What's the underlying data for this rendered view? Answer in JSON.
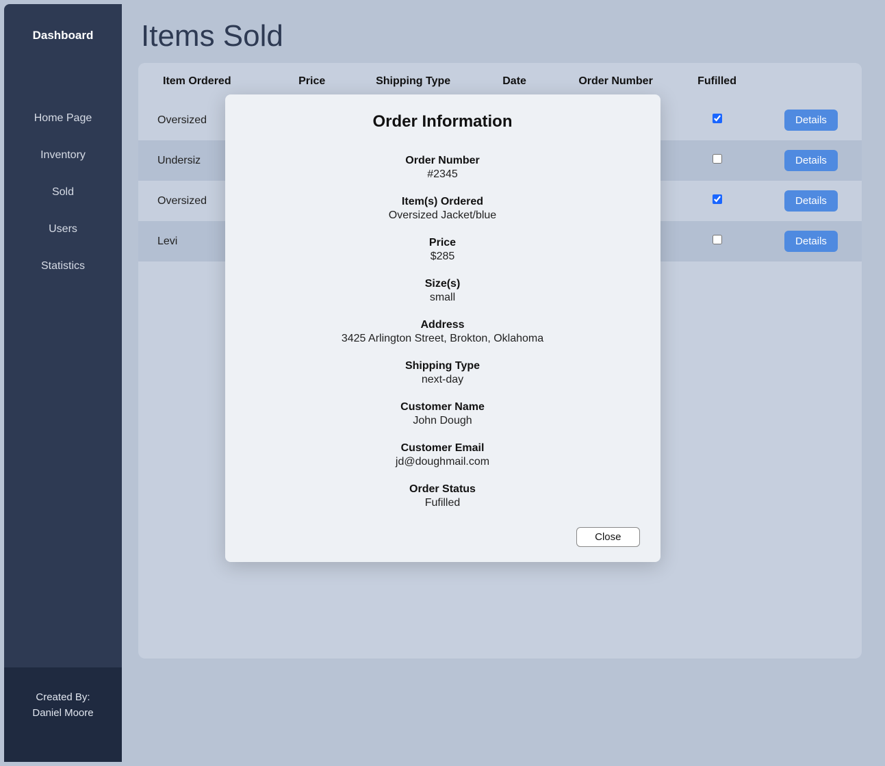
{
  "sidebar": {
    "brand": "Dashboard",
    "items": [
      {
        "label": "Home Page"
      },
      {
        "label": "Inventory"
      },
      {
        "label": "Sold"
      },
      {
        "label": "Users"
      },
      {
        "label": "Statistics"
      }
    ],
    "footer_line1": "Created By:",
    "footer_line2": "Daniel Moore"
  },
  "page": {
    "title": "Items Sold"
  },
  "table": {
    "headers": {
      "item": "Item Ordered",
      "price": "Price",
      "shipping": "Shipping Type",
      "date": "Date",
      "order_no": "Order Number",
      "fulfilled": "Fufilled",
      "actions": ""
    },
    "details_label": "Details",
    "rows": [
      {
        "item": "Oversized",
        "fulfilled": true
      },
      {
        "item": "Undersiz",
        "fulfilled": false
      },
      {
        "item": "Oversized",
        "fulfilled": true
      },
      {
        "item": "Levi",
        "fulfilled": false
      }
    ]
  },
  "modal": {
    "title": "Order Information",
    "close_label": "Close",
    "sections": {
      "order_number": {
        "label": "Order Number",
        "value": "#2345"
      },
      "items_ordered": {
        "label": "Item(s) Ordered",
        "value": "Oversized Jacket/blue"
      },
      "price": {
        "label": "Price",
        "value": "$285"
      },
      "sizes": {
        "label": "Size(s)",
        "value": "small"
      },
      "address": {
        "label": "Address",
        "value": "3425 Arlington Street, Brokton, Oklahoma"
      },
      "shipping": {
        "label": "Shipping Type",
        "value": "next-day"
      },
      "customer_name": {
        "label": "Customer Name",
        "value": "John Dough"
      },
      "customer_email": {
        "label": "Customer Email",
        "value": "jd@doughmail.com"
      },
      "order_status": {
        "label": "Order Status",
        "value": "Fufilled"
      }
    }
  }
}
